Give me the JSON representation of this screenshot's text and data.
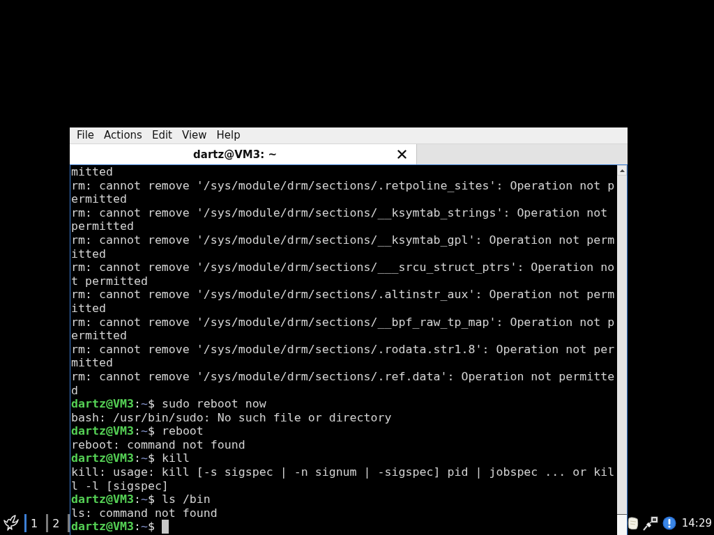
{
  "menu": [
    "File",
    "Actions",
    "Edit",
    "View",
    "Help"
  ],
  "tabs": [
    {
      "title": "dartz@VM3: ~",
      "selected": true
    }
  ],
  "terminal": {
    "lines": [
      {
        "kind": "output",
        "text": "mitted"
      },
      {
        "kind": "output",
        "text": "rm: cannot remove '/sys/module/drm/sections/.retpoline_sites': Operation not p"
      },
      {
        "kind": "output",
        "text": "ermitted"
      },
      {
        "kind": "output",
        "text": "rm: cannot remove '/sys/module/drm/sections/__ksymtab_strings': Operation not"
      },
      {
        "kind": "output",
        "text": "permitted"
      },
      {
        "kind": "output",
        "text": "rm: cannot remove '/sys/module/drm/sections/__ksymtab_gpl': Operation not perm"
      },
      {
        "kind": "output",
        "text": "itted"
      },
      {
        "kind": "output",
        "text": "rm: cannot remove '/sys/module/drm/sections/___srcu_struct_ptrs': Operation no"
      },
      {
        "kind": "output",
        "text": "t permitted"
      },
      {
        "kind": "output",
        "text": "rm: cannot remove '/sys/module/drm/sections/.altinstr_aux': Operation not perm"
      },
      {
        "kind": "output",
        "text": "itted"
      },
      {
        "kind": "output",
        "text": "rm: cannot remove '/sys/module/drm/sections/__bpf_raw_tp_map': Operation not p"
      },
      {
        "kind": "output",
        "text": "ermitted"
      },
      {
        "kind": "output",
        "text": "rm: cannot remove '/sys/module/drm/sections/.rodata.str1.8': Operation not per"
      },
      {
        "kind": "output",
        "text": "mitted"
      },
      {
        "kind": "output",
        "text": "rm: cannot remove '/sys/module/drm/sections/.ref.data': Operation not permitte"
      },
      {
        "kind": "output",
        "text": "d"
      },
      {
        "kind": "prompt",
        "user": "dartz@VM3",
        "separator": ":",
        "path": "~",
        "symbol": "$",
        "command": "sudo reboot now",
        "cursor": false
      },
      {
        "kind": "output",
        "text": "bash: /usr/bin/sudo: No such file or directory"
      },
      {
        "kind": "prompt",
        "user": "dartz@VM3",
        "separator": ":",
        "path": "~",
        "symbol": "$",
        "command": "reboot",
        "cursor": false
      },
      {
        "kind": "output",
        "text": "reboot: command not found"
      },
      {
        "kind": "prompt",
        "user": "dartz@VM3",
        "separator": ":",
        "path": "~",
        "symbol": "$",
        "command": "kill",
        "cursor": false
      },
      {
        "kind": "output",
        "text": "kill: usage: kill [-s sigspec | -n signum | -sigspec] pid | jobspec ... or kil"
      },
      {
        "kind": "output",
        "text": "l -l [sigspec]"
      },
      {
        "kind": "prompt",
        "user": "dartz@VM3",
        "separator": ":",
        "path": "~",
        "symbol": "$",
        "command": "ls /bin",
        "cursor": false
      },
      {
        "kind": "output",
        "text": "ls: command not found"
      },
      {
        "kind": "prompt",
        "user": "dartz@VM3",
        "separator": ":",
        "path": "~",
        "symbol": "$",
        "cursor": true
      }
    ]
  },
  "taskbar": {
    "workspaces": [
      {
        "label": "1",
        "selected": true
      },
      {
        "label": "2",
        "selected": false
      }
    ],
    "clock": "14:29"
  }
}
